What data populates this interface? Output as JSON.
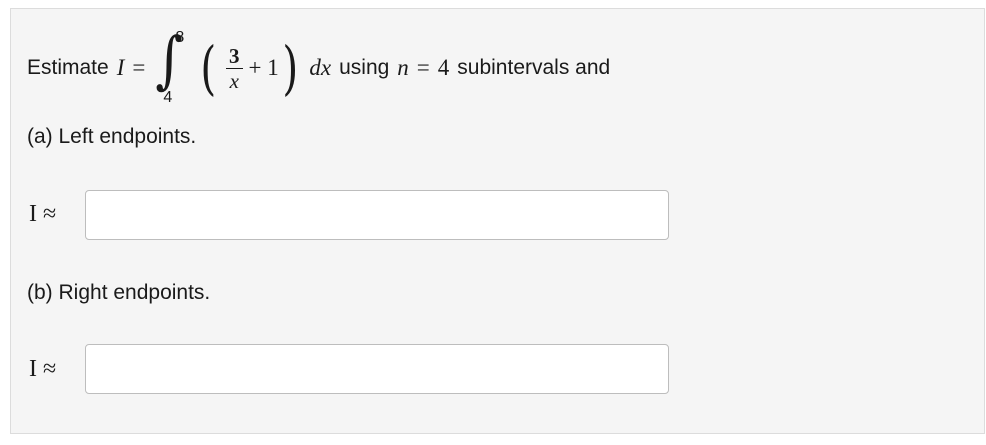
{
  "question": {
    "estimate_label": "Estimate",
    "var_I": "I",
    "eq": "=",
    "upper_limit": "8",
    "lower_limit": "4",
    "numerator": "3",
    "denominator": "x",
    "plus_one": "+ 1",
    "dx": "dx",
    "using_text": "using",
    "n_var": "n",
    "n_eq": "=",
    "n_val": "4",
    "suffix_text": "subintervals and"
  },
  "parts": [
    {
      "label": "(a) Left endpoints.",
      "approx_label": "I ≈",
      "value": "",
      "placeholder": ""
    },
    {
      "label": "(b) Right endpoints.",
      "approx_label": "I ≈",
      "value": "",
      "placeholder": ""
    }
  ]
}
